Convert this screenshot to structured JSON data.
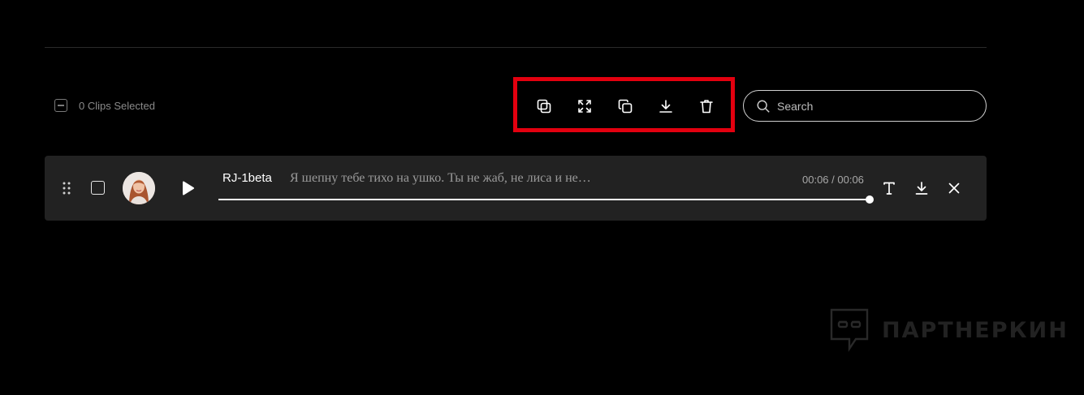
{
  "selection": {
    "count_label": "0 Clips Selected"
  },
  "toolbar": {
    "buttons": [
      {
        "name": "merge-clips-icon"
      },
      {
        "name": "expand-icon"
      },
      {
        "name": "duplicate-icon"
      },
      {
        "name": "download-icon"
      },
      {
        "name": "trash-icon"
      }
    ],
    "highlight_color": "#e3000f"
  },
  "search": {
    "placeholder": "Search",
    "value": ""
  },
  "clip": {
    "voice": "RJ-1beta",
    "text": "Я шепну тебе тихо на ушко. Ты не жаб, не лиса и не…",
    "time": "00:06 / 00:06",
    "progress_percent": 100
  },
  "watermark": {
    "text": "ПАРТНЕРКИН"
  }
}
